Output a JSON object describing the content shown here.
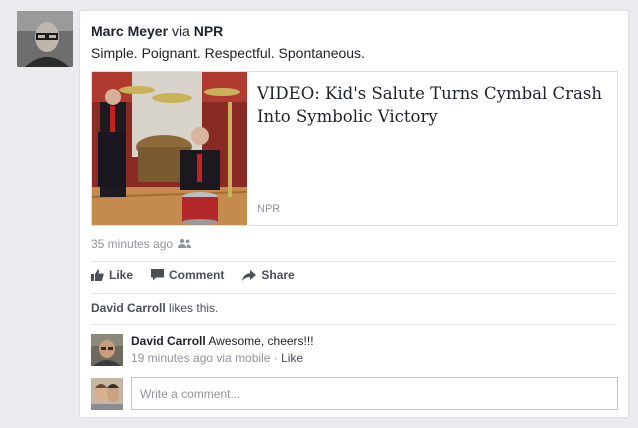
{
  "post": {
    "author": "Marc Meyer",
    "via": "via",
    "source": "NPR",
    "text": "Simple. Poignant. Respectful. Spontaneous.",
    "link": {
      "title": "VIDEO: Kid's Salute Turns Cymbal Crash Into Symbolic Victory",
      "source": "NPR"
    },
    "timestamp": "35 minutes ago",
    "audience_icon": "friends-icon"
  },
  "actions": {
    "like": "Like",
    "comment": "Comment",
    "share": "Share"
  },
  "likes": {
    "name": "David Carroll",
    "suffix": " likes this."
  },
  "comment": {
    "author": "David Carroll",
    "text": " Awesome, cheers!!!",
    "time": "19 minutes ago via mobile",
    "separator": " · ",
    "like": "Like"
  },
  "composer": {
    "placeholder": "Write a comment..."
  },
  "colors": {
    "background": "#e9ebee",
    "card_border": "#dddfe2",
    "meta_text": "#90949c",
    "action_text": "#4b4f56"
  }
}
